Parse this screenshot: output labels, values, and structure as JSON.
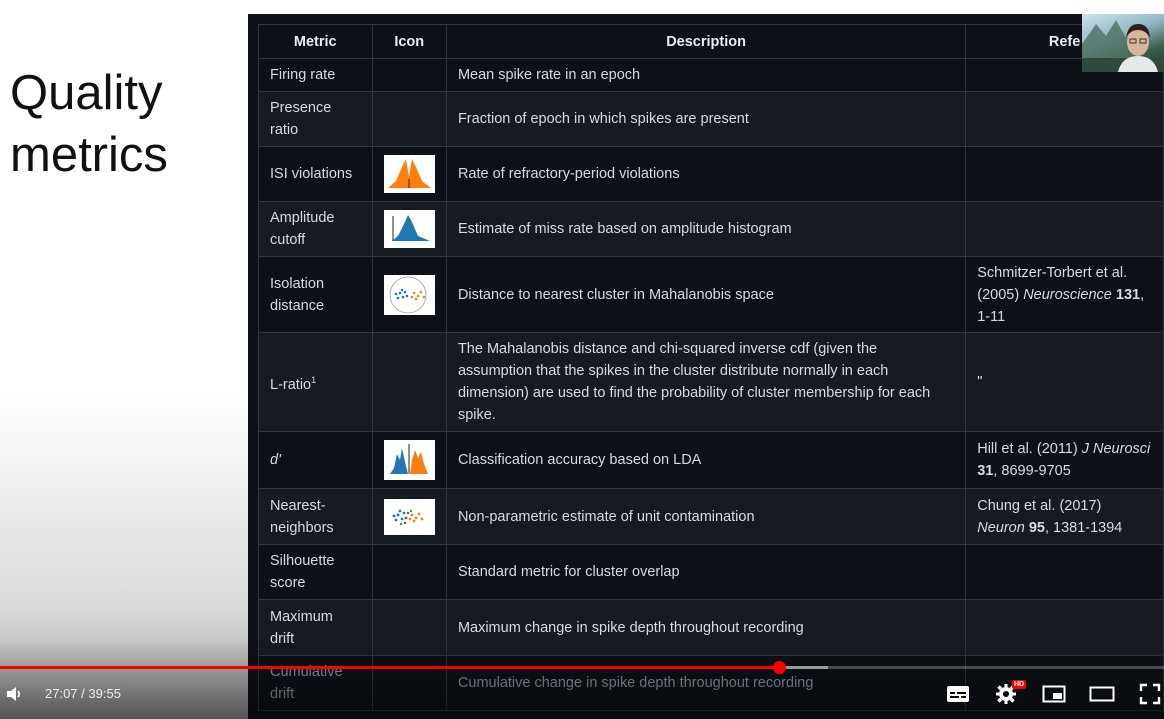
{
  "slide": {
    "title_line1": "Quality",
    "title_line2": "metrics"
  },
  "table": {
    "headers": [
      "Metric",
      "Icon",
      "Description",
      "Refe"
    ],
    "rows": [
      {
        "metric": "Firing rate",
        "description": "Mean spike rate in an epoch",
        "reference": ""
      },
      {
        "metric": "Presence ratio",
        "description": "Fraction of epoch in which spikes are present",
        "reference": ""
      },
      {
        "metric": "ISI violations",
        "description": "Rate of refractory-period violations",
        "reference": ""
      },
      {
        "metric": "Amplitude cutoff",
        "description": "Estimate of miss rate based on amplitude histogram",
        "reference": ""
      },
      {
        "metric": "Isolation distance",
        "description": "Distance to nearest cluster in Mahalanobis space",
        "ref_a": "Schmitzer-Torbert et al. (2005) ",
        "ref_journal": "Neuroscience",
        "ref_vol": " 131",
        "ref_b": ", 1-11"
      },
      {
        "metric": "L-ratio",
        "metric_sup": "1",
        "description": "The Mahalanobis distance and chi-squared inverse cdf (given the assumption that the spikes in the cluster distribute normally in each dimension) are used to find the probability of cluster membership for each spike.",
        "reference": "\""
      },
      {
        "metric": "d'",
        "description": "Classification accuracy based on LDA",
        "ref_a": "Hill et al. (2011) ",
        "ref_journal": "J Neurosci",
        "ref_vol": "31",
        "ref_b": ", 8699-9705"
      },
      {
        "metric": "Nearest-neighbors",
        "description": "Non-parametric estimate of unit contamination",
        "ref_a": "Chung et al. (2017) ",
        "ref_journal": "Neuron",
        "ref_vol": " 95",
        "ref_b": ", 1381-1394"
      },
      {
        "metric": "Silhouette score",
        "description": "Standard metric for cluster overlap",
        "reference": ""
      },
      {
        "metric": "Maximum drift",
        "description": "Maximum change in spike depth throughout recording",
        "reference": ""
      },
      {
        "metric": "Cumulative drift",
        "description": "Cumulative change in spike depth throughout recording",
        "reference": ""
      }
    ]
  },
  "player": {
    "current_time": "27:07",
    "separator": " / ",
    "duration": "39:55",
    "progress_fraction": 0.679,
    "buffered_fraction": 0.711,
    "hd_badge": "HD",
    "accent_color": "#ff0000",
    "icons": [
      "volume-icon",
      "subtitles-icon",
      "settings-icon",
      "miniplayer-icon",
      "theater-mode-icon",
      "fullscreen-icon"
    ]
  },
  "colors": {
    "isi_orange": "#ff7f0e",
    "amp_blue": "#1f77b4"
  }
}
